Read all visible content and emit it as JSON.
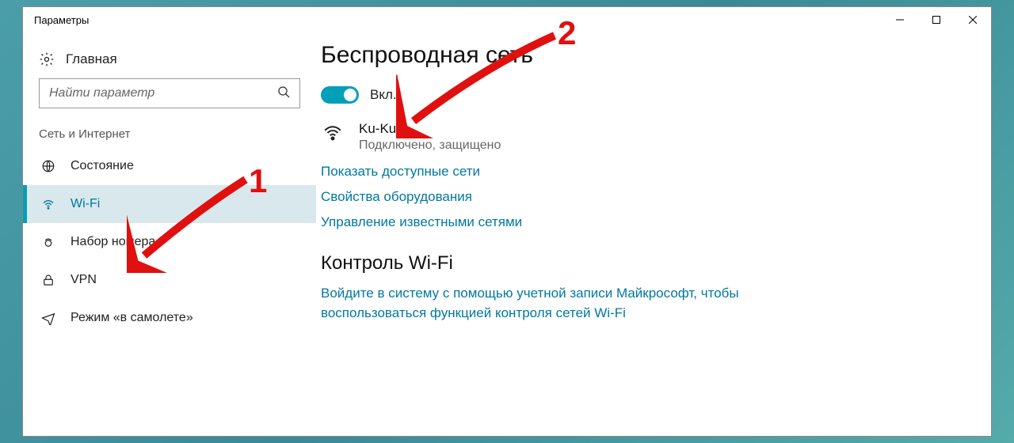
{
  "window": {
    "title": "Параметры"
  },
  "sidebar": {
    "home_label": "Главная",
    "search_placeholder": "Найти параметр",
    "category": "Сеть и Интернет",
    "items": [
      {
        "label": "Состояние"
      },
      {
        "label": "Wi-Fi"
      },
      {
        "label": "Набор номера"
      },
      {
        "label": "VPN"
      },
      {
        "label": "Режим «в самолете»"
      }
    ]
  },
  "main": {
    "title": "Беспроводная сеть",
    "toggle_label": "Вкл.",
    "network": {
      "name": "Ku-Ku",
      "status": "Подключено, защищено"
    },
    "links": {
      "available": "Показать доступные сети",
      "hw": "Свойства оборудования",
      "known": "Управление известными сетями"
    },
    "sense": {
      "title": "Контроль Wi-Fi",
      "text": "Войдите в систему с помощью учетной записи Майкрософт, чтобы воспользоваться функцией контроля сетей Wi-Fi"
    }
  },
  "annotations": {
    "one": "1",
    "two": "2"
  }
}
